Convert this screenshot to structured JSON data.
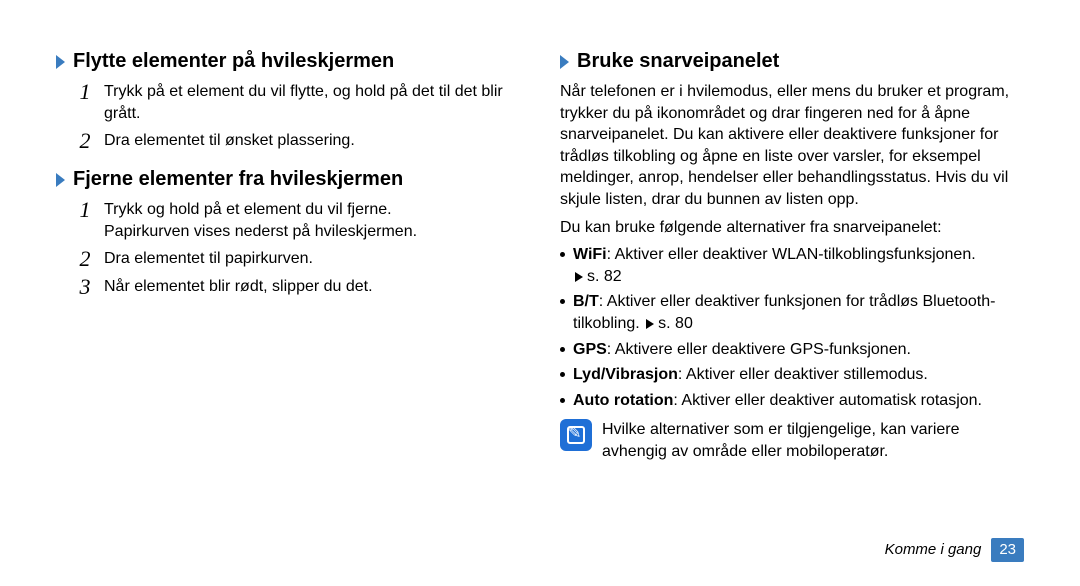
{
  "left": {
    "section1": {
      "heading": "Flytte elementer på hvileskjermen",
      "steps": [
        {
          "num": "1",
          "text": "Trykk på et element du vil flytte, og hold på det til det blir grått."
        },
        {
          "num": "2",
          "text": "Dra elementet til ønsket plassering."
        }
      ]
    },
    "section2": {
      "heading": "Fjerne elementer fra hvileskjermen",
      "steps": [
        {
          "num": "1",
          "text": "Trykk og hold på et element du vil fjerne.",
          "sub": "Papirkurven vises nederst på hvileskjermen."
        },
        {
          "num": "2",
          "text": "Dra elementet til papirkurven."
        },
        {
          "num": "3",
          "text": "Når elementet blir rødt, slipper du det."
        }
      ]
    }
  },
  "right": {
    "heading": "Bruke snarveipanelet",
    "intro1": "Når telefonen er i hvilemodus, eller mens du bruker et program, trykker du på ikonområdet og drar fingeren ned for å åpne snarveipanelet. Du kan aktivere eller deaktivere funksjoner for trådløs tilkobling og åpne en liste over varsler, for eksempel meldinger, anrop, hendelser eller behandlingsstatus. Hvis du vil skjule listen, drar du bunnen av listen opp.",
    "intro2": "Du kan bruke følgende alternativer fra snarveipanelet:",
    "bullets": [
      {
        "bold": "WiFi",
        "text": ": Aktiver eller deaktiver WLAN-tilkoblingsfunksjonen.",
        "ref": "s. 82"
      },
      {
        "bold": "B/T",
        "text": ": Aktiver eller deaktiver funksjonen for trådløs Bluetooth-tilkobling. ",
        "ref": "s. 80"
      },
      {
        "bold": "GPS",
        "text": ": Aktivere eller deaktivere GPS-funksjonen."
      },
      {
        "bold": "Lyd/Vibrasjon",
        "text": ": Aktiver eller deaktiver stillemodus."
      },
      {
        "bold": "Auto rotation",
        "text": ": Aktiver eller deaktiver automatisk rotasjon."
      }
    ],
    "note": "Hvilke alternativer som er tilgjengelige, kan variere avhengig av område eller mobiloperatør."
  },
  "footer": {
    "label": "Komme i gang",
    "page": "23"
  }
}
